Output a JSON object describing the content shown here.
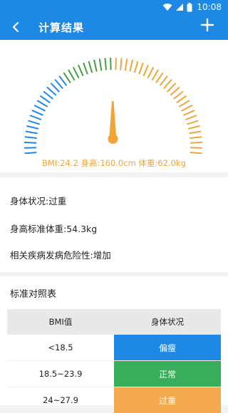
{
  "status_bar": {
    "time": "10:08"
  },
  "header": {
    "title": "计算结果"
  },
  "gauge": {
    "tick_colors": {
      "underweight": "#1e88e5",
      "normal": "#43a047",
      "overweight": "#f0a53a"
    },
    "caption": "BMI:24.2  身高:160.0cm  体重:62.0kg"
  },
  "info": {
    "status": "身体状况:过重",
    "standard_weight": "身高标准体重:54.3kg",
    "risk": "相关疾病发病危险性:增加"
  },
  "reference_table": {
    "title": "标准对照表",
    "headers": [
      "BMI值",
      "身体状况"
    ],
    "rows": [
      {
        "range": "<18.5",
        "status": "偏瘦",
        "color": "#1e88e5"
      },
      {
        "range": "18.5~23.9",
        "status": "正常",
        "color": "#3aad5c"
      },
      {
        "range": "24~27.9",
        "status": "过重",
        "color": "#f5a94e"
      }
    ]
  }
}
